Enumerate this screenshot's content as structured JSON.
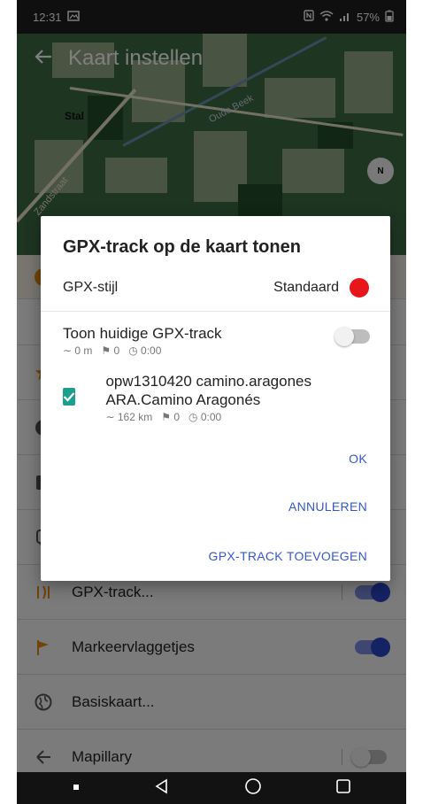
{
  "status_bar": {
    "time": "12:31",
    "battery": "57%",
    "icons": [
      "gallery-icon",
      "nfc-icon",
      "wifi-icon",
      "signal-icon",
      "battery-icon"
    ]
  },
  "app_bar": {
    "back_icon": "arrow-back-icon",
    "title": "Kaart instellen"
  },
  "map": {
    "place_label": "Stal",
    "stream_label": "Oude Beek",
    "road_label": "Zandstraat",
    "compass_label": "N"
  },
  "settings_list": {
    "items": [
      {
        "label": "GPX-track...",
        "icon": "gpx-track-icon",
        "toggle": true
      },
      {
        "label": "Markeervlaggetjes",
        "icon": "flag-icon",
        "toggle": true
      },
      {
        "label": "Basiskaart...",
        "icon": "globe-icon",
        "toggle": null
      },
      {
        "label": "Mapillary",
        "icon": "mapillary-icon",
        "toggle": false
      }
    ]
  },
  "dialog": {
    "title": "GPX-track op de kaart tonen",
    "style_label": "GPX-stijl",
    "style_value": "Standaard",
    "style_color": "#e8151a",
    "tracks": [
      {
        "name": "Toon huidige GPX-track",
        "distance": "0 m",
        "waypoints": "0",
        "duration": "0:00",
        "toggle": false
      },
      {
        "name": "opw1310420 camino.aragones ARA.Camino Aragonés",
        "distance": "162 km",
        "waypoints": "0",
        "duration": "0:00",
        "checked": true
      }
    ],
    "buttons": {
      "ok": "OK",
      "cancel": "ANNULEREN",
      "add": "GPX-TRACK TOEVOEGEN"
    },
    "accent_color": "#3557c8",
    "checkbox_color": "#1c9f8f"
  },
  "colors": {
    "toggle_on": "#2a45c8",
    "flag": "#e08a12"
  }
}
